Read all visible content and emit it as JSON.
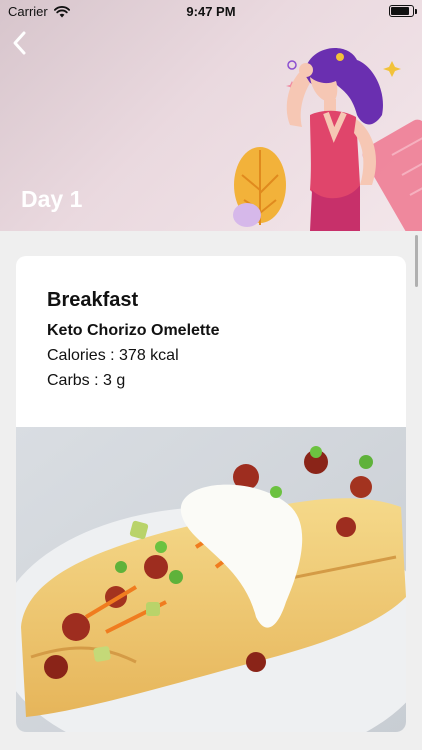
{
  "status_bar": {
    "carrier": "Carrier",
    "time": "9:47 PM"
  },
  "header": {
    "title": "Day 1"
  },
  "meal": {
    "title": "Breakfast",
    "dish": "Keto Chorizo Omelette",
    "calories": "Calories : 378 kcal",
    "carbs": "Carbs : 3 g"
  },
  "icons": [
    "wifi-icon",
    "battery-icon",
    "back-icon"
  ],
  "colors": {
    "header_bg": "#e4d3d9",
    "page_bg": "#efefef",
    "card_bg": "#ffffff",
    "accent": "#e0456b"
  }
}
